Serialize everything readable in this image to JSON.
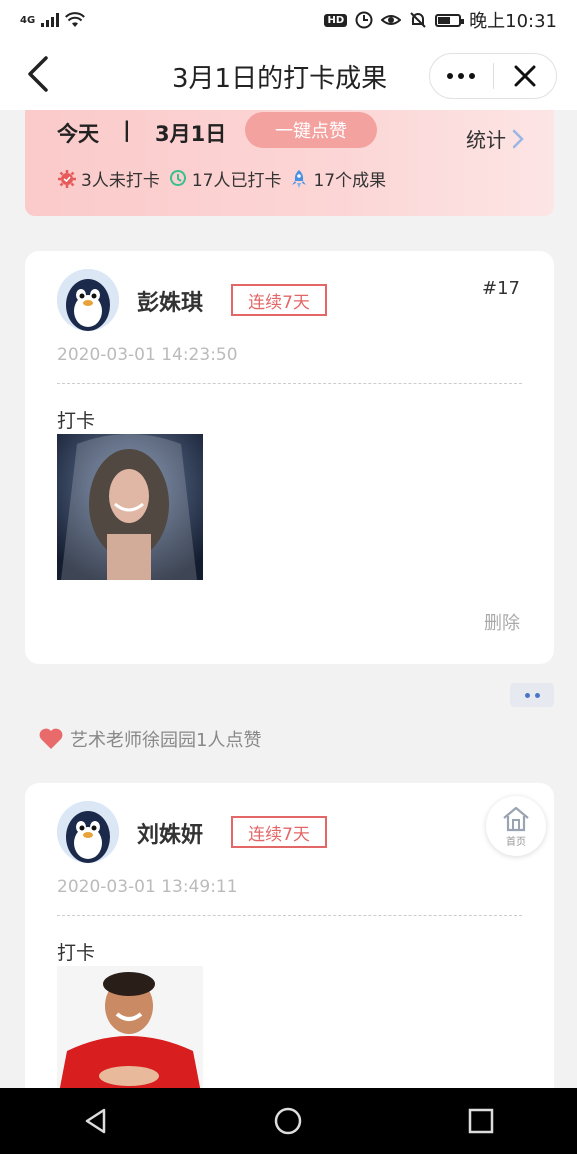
{
  "status_bar": {
    "network": "4G",
    "hd": "HD",
    "time": "晚上10:31",
    "battery_level": 0.55
  },
  "nav": {
    "title": "3月1日的打卡成果"
  },
  "summary": {
    "today": "今天",
    "separator": "|",
    "date": "3月1日",
    "like_all_label": "一键点赞",
    "stats_label": "统计",
    "metrics": [
      {
        "icon": "red-gear-icon",
        "text": "3人未打卡",
        "color": "#e85a5a"
      },
      {
        "icon": "green-clock-icon",
        "text": "17人已打卡",
        "color": "#3bbf8f"
      },
      {
        "icon": "blue-rocket-icon",
        "text": "17个成果",
        "color": "#4a90e2"
      }
    ]
  },
  "posts": [
    {
      "name": "彭姝琪",
      "streak": "连续7天",
      "rank": "#17",
      "timestamp": "2020-03-01 14:23:50",
      "text": "打卡",
      "delete_label": "删除"
    },
    {
      "name": "刘姝妍",
      "streak": "连续7天",
      "timestamp": "2020-03-01 13:49:11",
      "text": "打卡"
    }
  ],
  "likes": {
    "text": "艺术老师徐园园1人点赞"
  },
  "home_fab": {
    "label": "首页"
  }
}
